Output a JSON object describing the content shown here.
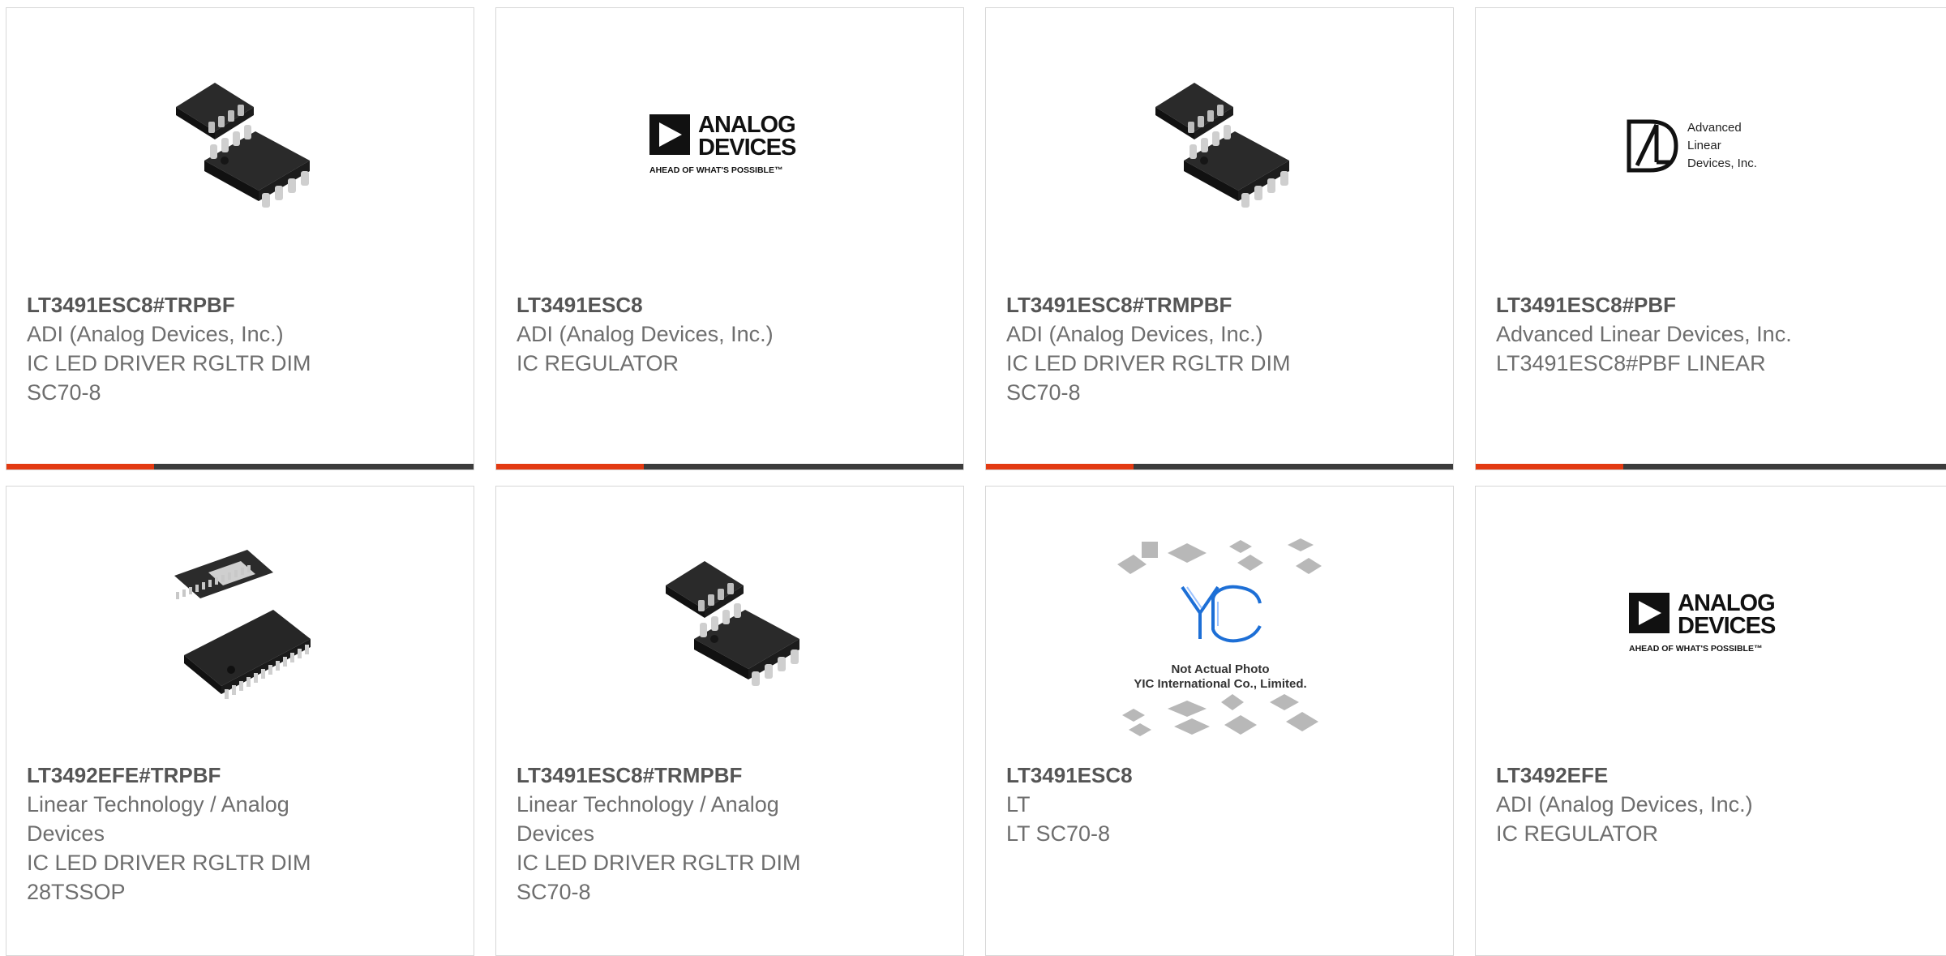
{
  "colors": {
    "accent": "#e33a12",
    "bar_dark": "#3c3c3c",
    "logo_blue": "#1d6fd6"
  },
  "products": [
    {
      "part": "LT3491ESC8#TRPBF",
      "lines": [
        "ADI (Analog Devices, Inc.)",
        "IC LED DRIVER RGLTR DIM",
        "SC70-8"
      ],
      "image": "soic8-package-icon"
    },
    {
      "part": "LT3491ESC8",
      "lines": [
        "ADI (Analog Devices, Inc.)",
        "IC REGULATOR"
      ],
      "image": "analog-devices-logo"
    },
    {
      "part": "LT3491ESC8#TRMPBF",
      "lines": [
        "ADI (Analog Devices, Inc.)",
        "IC LED DRIVER RGLTR DIM",
        "SC70-8"
      ],
      "image": "soic8-package-icon"
    },
    {
      "part": "LT3491ESC8#PBF",
      "lines": [
        "Advanced Linear Devices, Inc.",
        "LT3491ESC8#PBF LINEAR"
      ],
      "image": "advanced-linear-devices-logo"
    },
    {
      "part": "LT3492EFE#TRPBF",
      "lines": [
        "Linear Technology / Analog",
        "Devices",
        "IC LED DRIVER RGLTR DIM",
        "28TSSOP"
      ],
      "image": "tssop-package-icon"
    },
    {
      "part": "LT3491ESC8#TRMPBF",
      "lines": [
        "Linear Technology / Analog",
        "Devices",
        "IC LED DRIVER RGLTR DIM",
        "SC70-8"
      ],
      "image": "soic8-package-icon"
    },
    {
      "part": "LT3491ESC8",
      "lines": [
        "LT",
        "LT SC70-8"
      ],
      "image": "yic-placeholder-image"
    },
    {
      "part": "LT3492EFE",
      "lines": [
        "ADI (Analog Devices, Inc.)",
        "IC REGULATOR"
      ],
      "image": "analog-devices-logo"
    }
  ],
  "logos": {
    "analog_devices": {
      "name_line1": "ANALOG",
      "name_line2": "DEVICES",
      "tagline": "AHEAD OF WHAT'S POSSIBLE™"
    },
    "advanced_linear": {
      "line1": "Advanced",
      "line2": "Linear",
      "line3": "Devices, Inc."
    },
    "yic": {
      "brand": "YIC",
      "caption1": "Not Actual Photo",
      "caption2": "YIC International Co., Limited."
    }
  }
}
